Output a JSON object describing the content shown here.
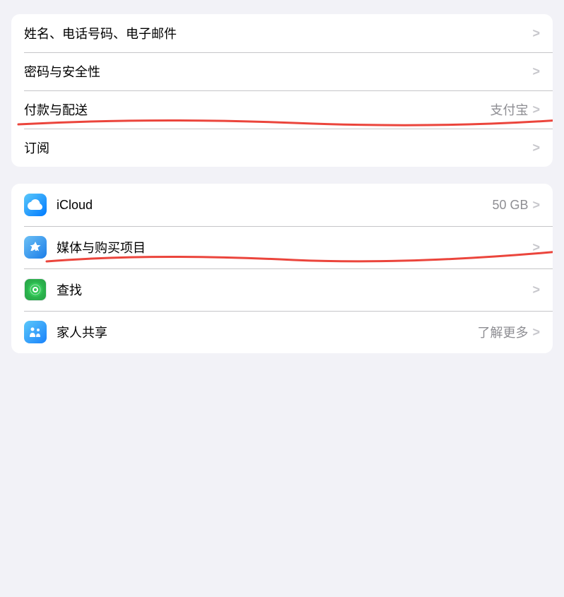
{
  "groups": [
    {
      "id": "account-group-1",
      "rows": [
        {
          "id": "name-phone-email",
          "label": "姓名、电话号码、电子邮件",
          "value": "",
          "icon": null,
          "chevron": ">"
        },
        {
          "id": "password-security",
          "label": "密码与安全性",
          "value": "",
          "icon": null,
          "chevron": ">"
        },
        {
          "id": "payment-delivery",
          "label": "付款与配送",
          "value": "支付宝",
          "icon": null,
          "chevron": ">"
        },
        {
          "id": "subscriptions",
          "label": "订阅",
          "value": "",
          "icon": null,
          "chevron": ">"
        }
      ]
    },
    {
      "id": "services-group",
      "rows": [
        {
          "id": "icloud",
          "label": "iCloud",
          "value": "50 GB",
          "icon": "icloud",
          "chevron": ">"
        },
        {
          "id": "media-purchases",
          "label": "媒体与购买项目",
          "value": "",
          "icon": "appstore",
          "chevron": ">"
        },
        {
          "id": "find-my",
          "label": "查找",
          "value": "",
          "icon": "findmy",
          "chevron": ">"
        },
        {
          "id": "family-sharing",
          "label": "家人共享",
          "value": "了解更多",
          "icon": "family",
          "chevron": ">"
        }
      ]
    }
  ],
  "annotations": {
    "line1": {
      "desc": "red underline on 付款与配送 row"
    },
    "line2": {
      "desc": "red underline on 媒体与购买项目 row"
    }
  }
}
